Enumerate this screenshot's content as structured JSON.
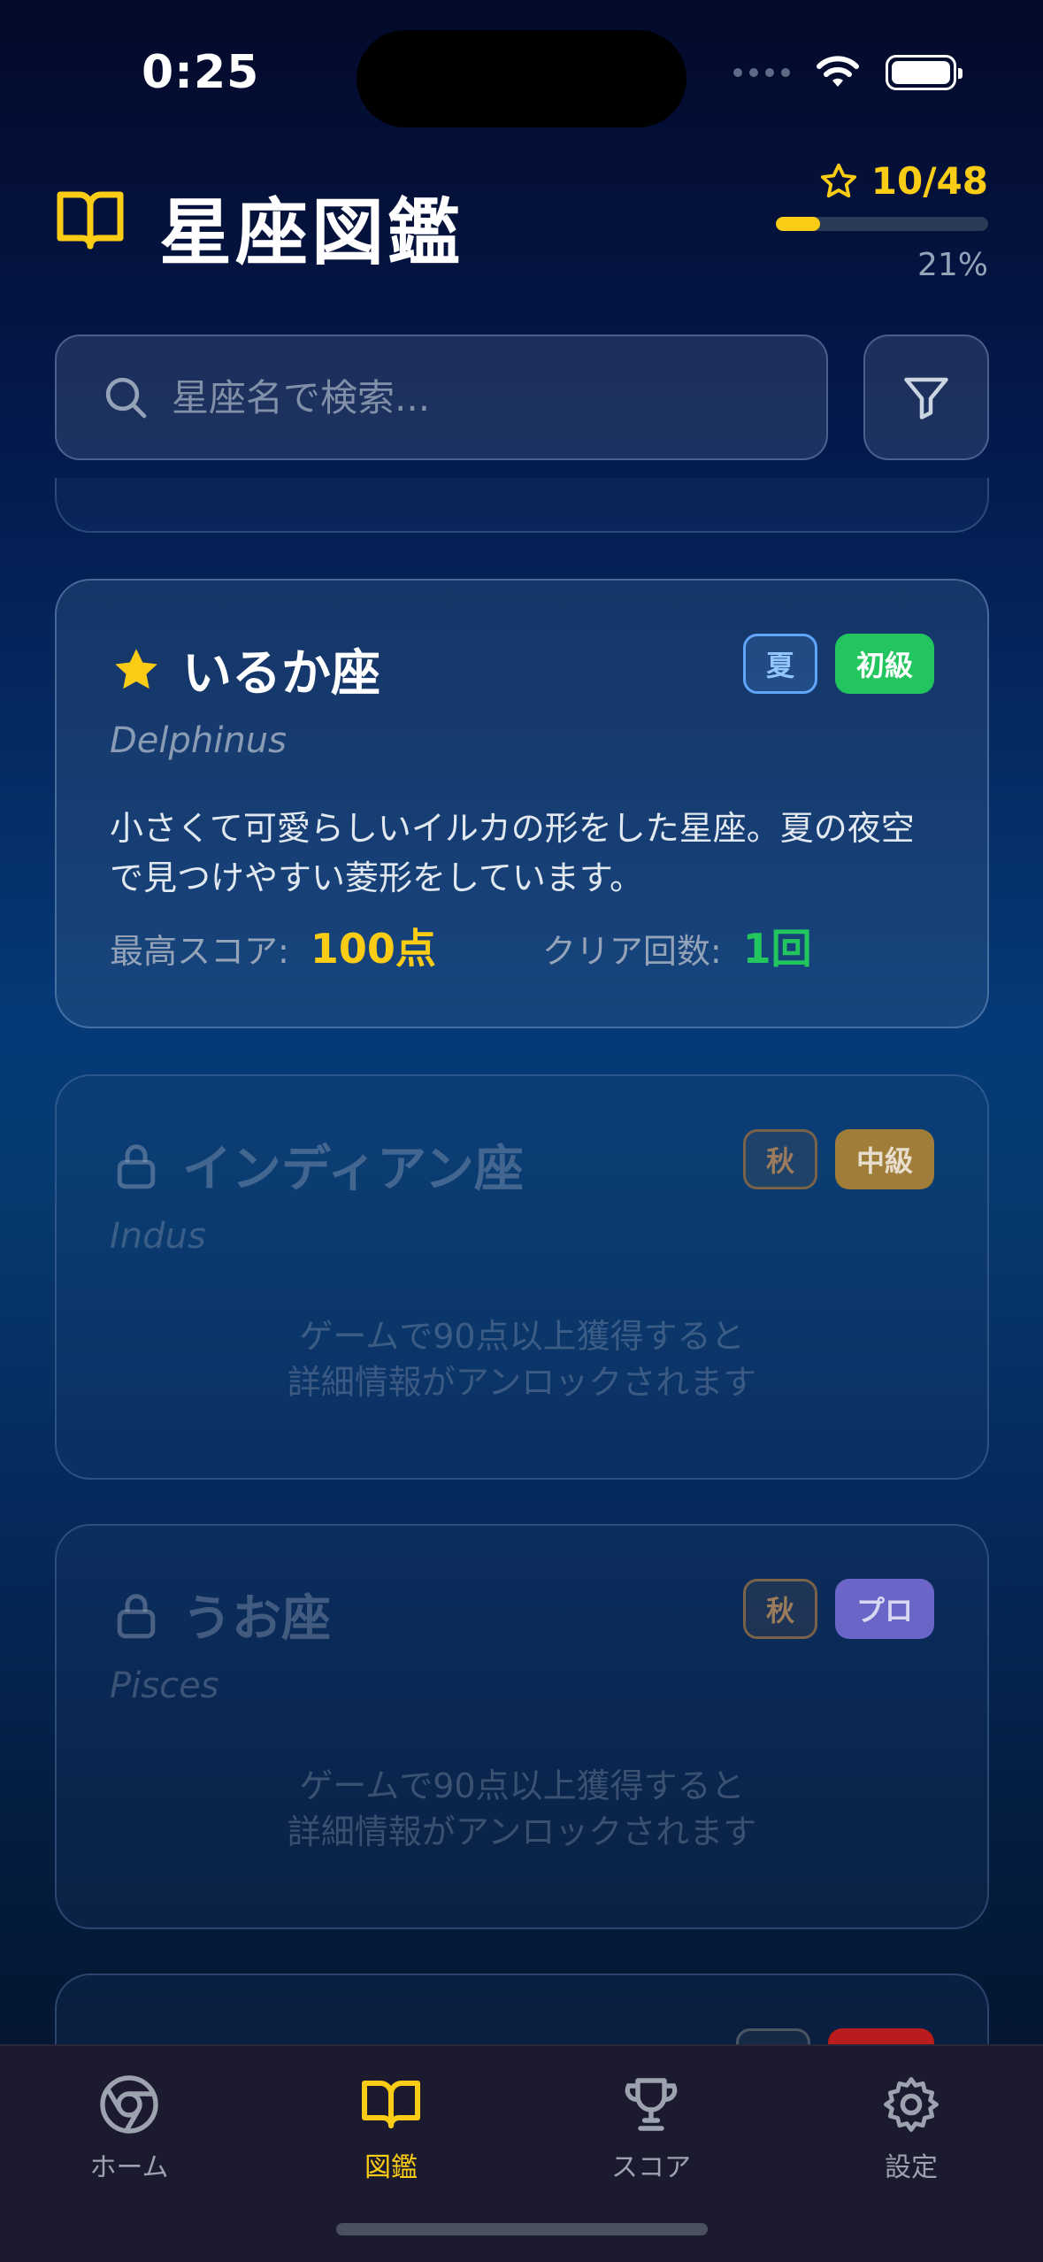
{
  "status_bar": {
    "time": "0:25"
  },
  "header": {
    "title": "星座図鑑",
    "progress_label": "10/48",
    "progress_fraction": 0.21,
    "progress_percent": "21%"
  },
  "search": {
    "placeholder": "星座名で検索..."
  },
  "cards": [
    {
      "name": "いるか座",
      "latin": "Delphinus",
      "season": "夏",
      "level": "初級",
      "description": "小さくて可愛らしいイルカの形をした星座。夏の夜空で見つけやすい菱形をしています。",
      "best_score_label": "最高スコア:",
      "best_score": "100点",
      "clear_count_label": "クリア回数:",
      "clear_count": "1回"
    },
    {
      "name": "インディアン座",
      "latin": "Indus",
      "season": "秋",
      "level": "中級",
      "locked_line1": "ゲームで90点以上獲得すると",
      "locked_line2": "詳細情報がアンロックされます"
    },
    {
      "name": "うお座",
      "latin": "Pisces",
      "season": "秋",
      "level": "プロ",
      "locked_line1": "ゲームで90点以上獲得すると",
      "locked_line2": "詳細情報がアンロックされます"
    }
  ],
  "colors": {
    "accent_yellow": "#facc15",
    "beginner_green": "#22c55e",
    "intermediate_gold": "#a17d3a",
    "pro_purple": "#6a66c8",
    "summer_blue": "#60a5fa",
    "autumn_brown": "#9a7b5c"
  },
  "tabs": [
    {
      "label": "ホーム",
      "icon": "home-icon"
    },
    {
      "label": "図鑑",
      "icon": "book-icon",
      "active": true
    },
    {
      "label": "スコア",
      "icon": "trophy-icon"
    },
    {
      "label": "設定",
      "icon": "gear-icon"
    }
  ]
}
